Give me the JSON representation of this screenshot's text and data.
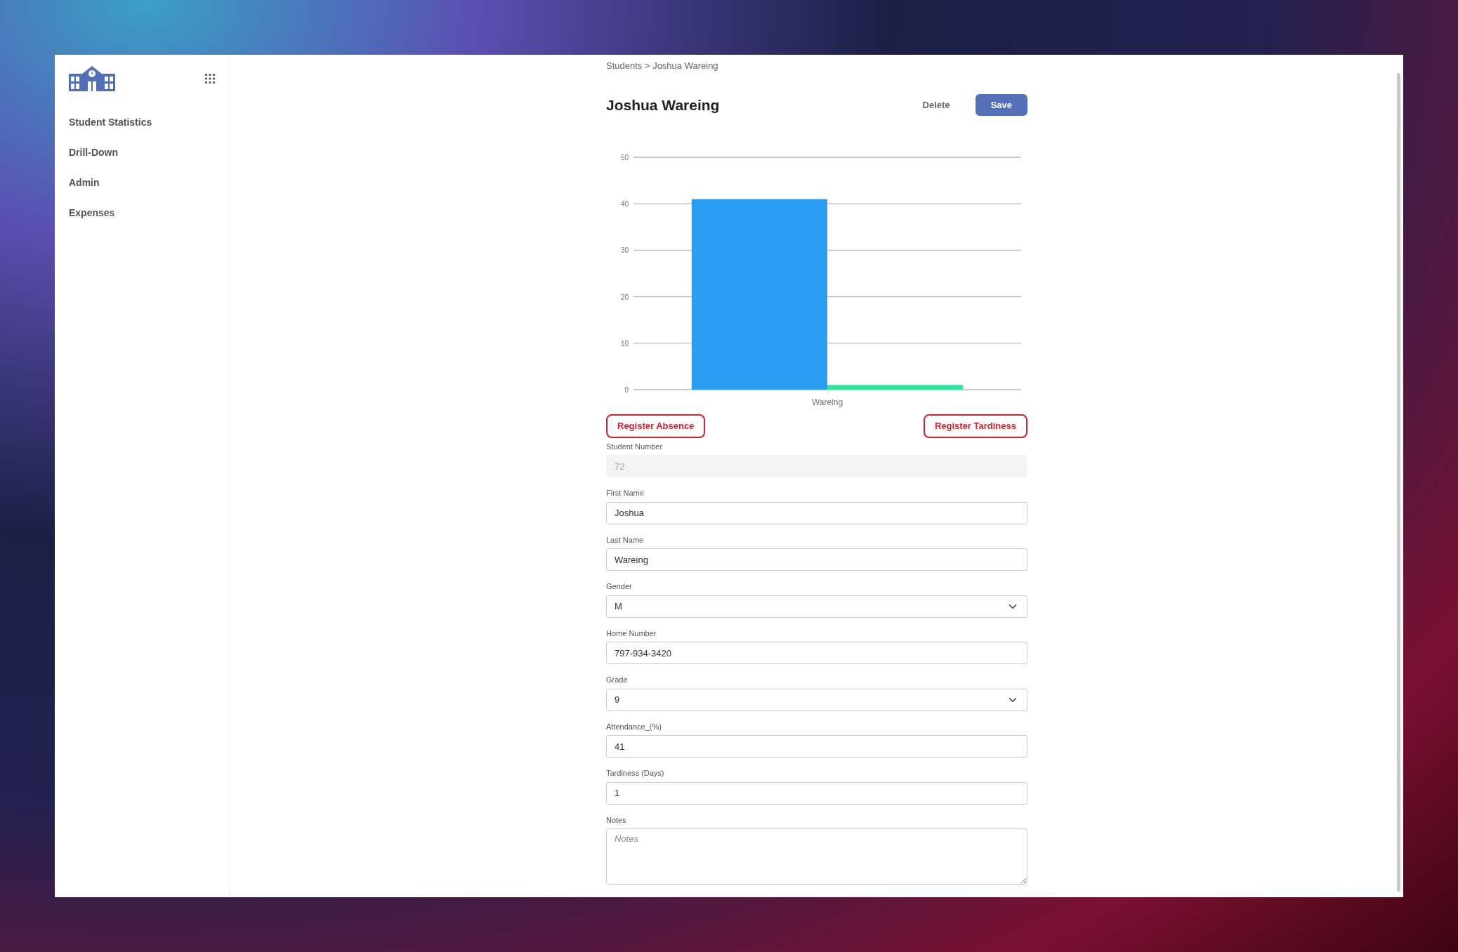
{
  "sidebar": {
    "items": [
      {
        "label": "Student Statistics"
      },
      {
        "label": "Drill-Down"
      },
      {
        "label": "Admin"
      },
      {
        "label": "Expenses"
      }
    ]
  },
  "breadcrumb": {
    "parent": "Students",
    "separator": ">",
    "current": "Joshua Wareing"
  },
  "header": {
    "title": "Joshua Wareing",
    "buttons": [
      {
        "label": "Delete",
        "kind": "link"
      },
      {
        "label": "Save",
        "kind": "primary"
      }
    ]
  },
  "chart_data": {
    "type": "bar",
    "categories": [
      "Wareing"
    ],
    "series": [
      {
        "color": "#2a9df4",
        "values": [
          41
        ]
      },
      {
        "color": "#2ee59d",
        "values": [
          1
        ]
      }
    ],
    "ylim": [
      0,
      50
    ],
    "grid": true,
    "yticks": [
      0,
      10,
      20,
      30,
      40,
      50
    ]
  },
  "actions": [
    {
      "label": "Register Absence"
    },
    {
      "label": "Register Tardiness"
    }
  ],
  "form": [
    {
      "label": "Student Number",
      "kind": "text",
      "value": "72",
      "disabled": true
    },
    {
      "label": "First Name",
      "kind": "text",
      "value": "Joshua",
      "disabled": false
    },
    {
      "label": "Last Name",
      "kind": "text",
      "value": "Wareing",
      "disabled": false
    },
    {
      "label": "Gender",
      "kind": "select",
      "value": "M",
      "disabled": false
    },
    {
      "label": "Home Number",
      "kind": "text",
      "value": "797-934-3420",
      "disabled": false
    },
    {
      "label": "Grade",
      "kind": "select",
      "value": "9",
      "disabled": false
    },
    {
      "label": "Attendance_(%)",
      "kind": "text",
      "value": "41",
      "disabled": false
    },
    {
      "label": "Tardiness (Days)",
      "kind": "text",
      "value": "1",
      "disabled": false
    },
    {
      "label": "Notes",
      "kind": "textarea",
      "placeholder": "Notes",
      "disabled": false
    }
  ]
}
